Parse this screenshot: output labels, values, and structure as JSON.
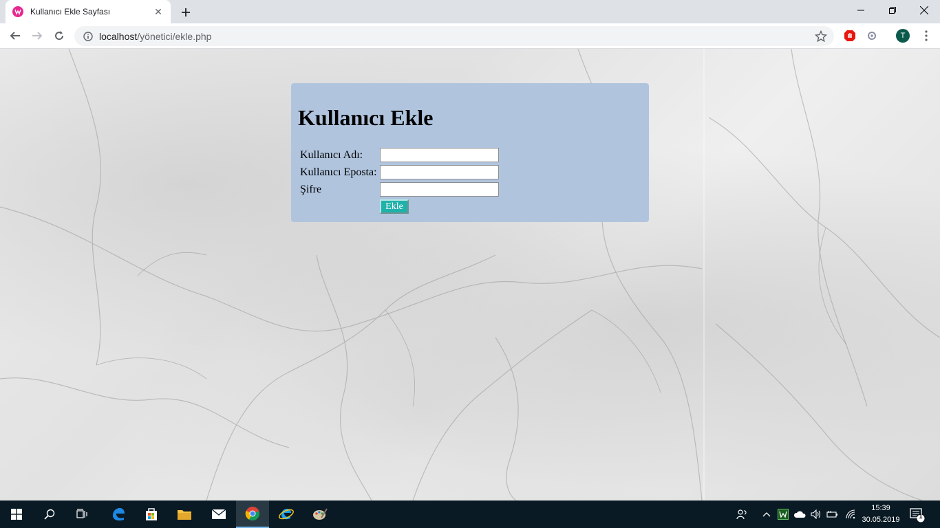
{
  "tab": {
    "title": "Kullanıcı Ekle Sayfası",
    "close": "✕"
  },
  "url": {
    "host": "localhost",
    "path": "/yönetici/ekle.php"
  },
  "avatar": {
    "letter": "T"
  },
  "form": {
    "heading": "Kullanıcı Ekle",
    "fields": [
      {
        "label": "Kullanıcı Adı:",
        "value": ""
      },
      {
        "label": "Kullanıcı Eposta:",
        "value": ""
      },
      {
        "label": "Şifre",
        "value": ""
      }
    ],
    "submit_label": "Ekle"
  },
  "colors": {
    "panel": "#b0c4de",
    "button": "#20b2aa"
  },
  "taskbar": {
    "time": "15:39",
    "date": "30.05.2019",
    "notification_count": "1"
  }
}
